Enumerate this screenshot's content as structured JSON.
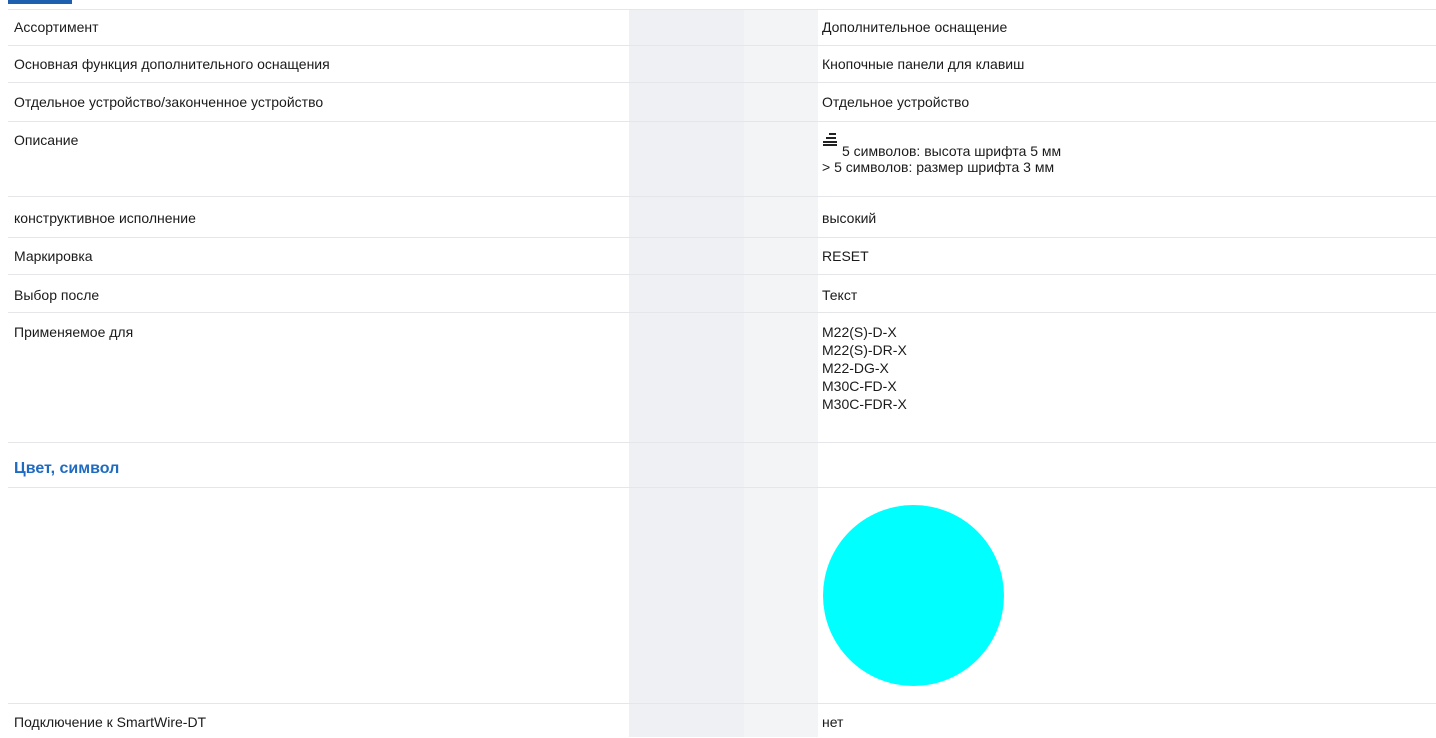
{
  "rows": [
    {
      "label": "Ассортимент",
      "value": "Дополнительное оснащение"
    },
    {
      "label": "Основная функция дополнительного оснащения",
      "value": "Кнопочные панели для клавиш"
    },
    {
      "label": "Отдельное устройство/законченное устройство",
      "value": "Отдельное устройство"
    },
    {
      "label": "Описание",
      "value_line1": "5 символов: высота шрифта 5 мм",
      "value_line2": "> 5 символов: размер шрифта 3 мм",
      "icon": "text-lines-icon"
    },
    {
      "label": "конструктивное исполнение",
      "value": "высокий"
    },
    {
      "label": "Маркировка",
      "value": "RESET"
    },
    {
      "label": "Выбор после",
      "value": "Текст"
    },
    {
      "label": "Применяемое для",
      "values": [
        "M22(S)-D-X",
        "M22(S)-DR-X",
        "M22-DG-X",
        "M30C-FD-X",
        "M30C-FDR-X"
      ]
    }
  ],
  "section": {
    "title": "Цвет, символ"
  },
  "color_swatch": {
    "color": "#00ffff"
  },
  "last_row": {
    "label": "Подключение к SmartWire-DT",
    "value": "нет"
  },
  "colors": {
    "accent": "#1f6bc1",
    "grey_column": "#eef0f3",
    "divider": "#e4e6ea"
  }
}
